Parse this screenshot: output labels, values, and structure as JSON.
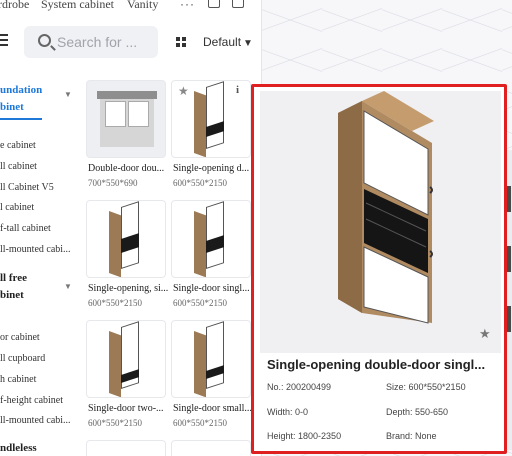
{
  "tabs": [
    "rdrobe",
    "System cabinet",
    "Vanity"
  ],
  "tabs_more": "···",
  "search": {
    "placeholder": "Search for ..."
  },
  "sort": {
    "label": "Default"
  },
  "categories": [
    {
      "title_line1": "undation",
      "title_line2": "binet",
      "active": true,
      "items": [
        "e cabinet",
        "ll cabinet",
        "ll Cabinet V5",
        "l cabinet",
        "f-tall cabinet",
        "ll-mounted cabi..."
      ]
    },
    {
      "title_line1": "ll free",
      "title_line2": "binet",
      "active": false,
      "items": [
        "or cabinet",
        "ll cupboard",
        "h cabinet",
        "f-height cabinet",
        "ll-mounted cabi..."
      ]
    },
    {
      "title_line1": "ndleless",
      "title_line2": "",
      "active": false,
      "items": []
    }
  ],
  "products": [
    {
      "name": "Double-door dou...",
      "dims": "700*550*690"
    },
    {
      "name": "Single-opening d...",
      "dims": "600*550*2150"
    },
    {
      "name": "Single-opening, si...",
      "dims": "600*550*2150"
    },
    {
      "name": "Single-door singl...",
      "dims": "600*550*2150"
    },
    {
      "name": "Single-door two-...",
      "dims": "600*550*2150"
    },
    {
      "name": "Single-door small...",
      "dims": "600*550*2150"
    }
  ],
  "detail": {
    "title": "Single-opening double-door singl...",
    "no_label": "No.: ",
    "no_value": "200200499",
    "size_label": "Size: ",
    "size_value": "600*550*2150",
    "width_label": "Width: ",
    "width_value": "0-0",
    "depth_label": "Depth: ",
    "depth_value": "550-650",
    "height_label": "Height: ",
    "height_value": "1800-2350",
    "brand_label": "Brand: ",
    "brand_value": "None"
  },
  "colors": {
    "accent": "#1e78d8",
    "highlight_border": "#e02020",
    "wood": "#9b7a55"
  },
  "icons": [
    "list-icon",
    "search-icon",
    "grid-view-icon",
    "caret-down-icon",
    "star-icon",
    "info-icon",
    "chevron-down-icon"
  ]
}
